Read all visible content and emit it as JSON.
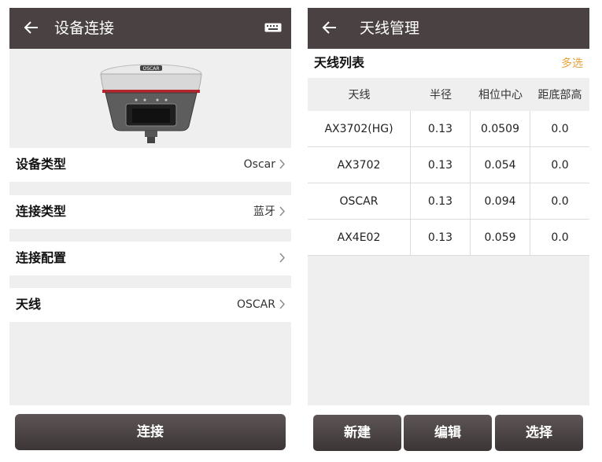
{
  "left": {
    "appbar": {
      "title": "设备连接",
      "back_icon": "arrow-left-icon",
      "right_icon": "keyboard-icon"
    },
    "device_image_label": "OSCAR",
    "rows": [
      {
        "label": "设备类型",
        "value": "Oscar"
      },
      {
        "label": "连接类型",
        "value": "蓝牙"
      },
      {
        "label": "连接配置",
        "value": ""
      },
      {
        "label": "天线",
        "value": "OSCAR"
      }
    ],
    "connect_label": "连接"
  },
  "right": {
    "appbar": {
      "title": "天线管理",
      "back_icon": "arrow-left-icon"
    },
    "list_title": "天线列表",
    "multi_select": "多选",
    "columns": [
      "天线",
      "半径",
      "相位中心",
      "距底部高"
    ],
    "rows": [
      [
        "AX3702(HG)",
        "0.13",
        "0.0509",
        "0.0"
      ],
      [
        "AX3702",
        "0.13",
        "0.054",
        "0.0"
      ],
      [
        "OSCAR",
        "0.13",
        "0.094",
        "0.0"
      ],
      [
        "AX4E02",
        "0.13",
        "0.059",
        "0.0"
      ]
    ],
    "buttons": {
      "new": "新建",
      "edit": "编辑",
      "select": "选择"
    }
  },
  "colors": {
    "appbar": "#4a4242",
    "accent": "#e8a23a",
    "background": "#efefef"
  }
}
